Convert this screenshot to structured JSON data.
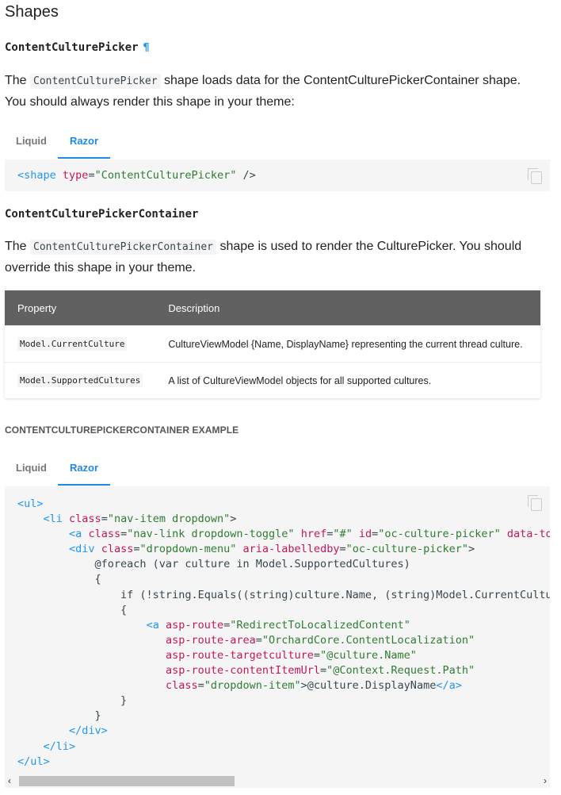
{
  "title": "Shapes",
  "section1": {
    "heading": "ContentCulturePicker",
    "anchor": "¶",
    "para_before": "The ",
    "para_code": "ContentCulturePicker",
    "para_after": " shape loads data for the ContentCulturePickerContainer shape. You should always render this shape in your theme:",
    "tabs": [
      "Liquid",
      "Razor"
    ],
    "active_tab": "Razor"
  },
  "section2": {
    "heading": "ContentCulturePickerContainer",
    "para_before": "The ",
    "para_code": "ContentCulturePickerContainer",
    "para_after": " shape is used to render the CulturePicker. You should override this shape in your theme."
  },
  "table": {
    "headers": [
      "Property",
      "Description"
    ],
    "rows": [
      {
        "property": "Model.CurrentCulture",
        "description": "CultureViewModel {Name, DisplayName} representing the current thread culture."
      },
      {
        "property": "Model.SupportedCultures",
        "description": "A list of CultureViewModel objects for all supported cultures."
      }
    ]
  },
  "example": {
    "title": "CONTENTCULTUREPICKERCONTAINER EXAMPLE",
    "tabs": [
      "Liquid",
      "Razor"
    ],
    "active_tab": "Razor"
  },
  "icons": {
    "copy": "copy-icon",
    "scroll_left": "‹",
    "scroll_right": "›"
  },
  "colors": {
    "accent": "#1e88e5",
    "table_header": "#616161",
    "code_bg": "#f5f5f5"
  }
}
